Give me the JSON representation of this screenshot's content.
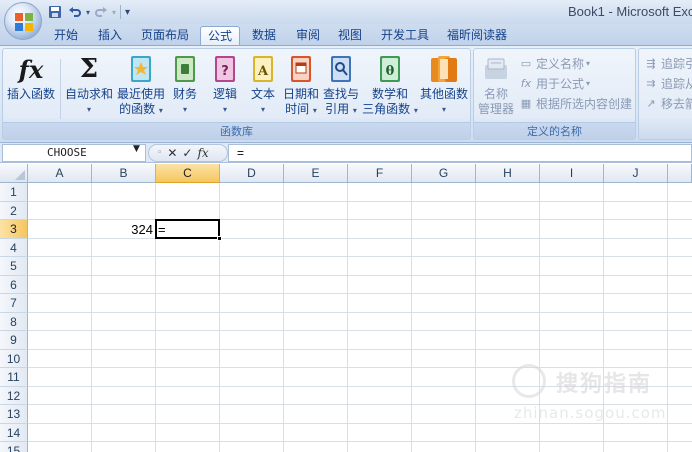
{
  "window": {
    "title": "Book1 - Microsoft Exc"
  },
  "quick_access": {
    "save": "save-icon",
    "undo": "undo-icon",
    "redo": "redo-icon",
    "customize": "▾"
  },
  "tabs": [
    "开始",
    "插入",
    "页面布局",
    "公式",
    "数据",
    "审阅",
    "视图",
    "开发工具",
    "福昕阅读器"
  ],
  "active_tab": "公式",
  "ribbon": {
    "function_library": {
      "label": "函数库",
      "insert_function": "插入函数",
      "autosum": "自动求和",
      "recent_l1": "最近使用",
      "recent_l2": "的函数",
      "financial": "财务",
      "logical": "逻辑",
      "text": "文本",
      "datetime_l1": "日期和",
      "datetime_l2": "时间",
      "lookup_l1": "查找与",
      "lookup_l2": "引用",
      "math_l1": "数学和",
      "math_l2": "三角函数",
      "more": "其他函数",
      "arrow": "▾"
    },
    "defined_names": {
      "label": "定义的名称",
      "name_manager_l1": "名称",
      "name_manager_l2": "管理器",
      "define_name": "定义名称",
      "use_in_formula": "用于公式",
      "create_from_selection": "根据所选内容创建"
    },
    "formula_auditing": {
      "trace_precedents": "追踪引",
      "trace_dependents": "追踪从",
      "remove_arrows": "移去箭"
    }
  },
  "formula_bar": {
    "name_box": "CHOOSE",
    "cancel": "✕",
    "enter": "✓",
    "fx": "fx",
    "content": "="
  },
  "sheet": {
    "columns": [
      "A",
      "B",
      "C",
      "D",
      "E",
      "F",
      "G",
      "H",
      "I",
      "J"
    ],
    "rows": [
      "1",
      "2",
      "3",
      "4",
      "5",
      "6",
      "7",
      "8",
      "9",
      "10",
      "11",
      "12",
      "13",
      "14",
      "15"
    ],
    "selected_column": "C",
    "selected_row": "3",
    "cells": {
      "B3": "324",
      "C3": "="
    }
  },
  "watermark": {
    "brand": "搜狗指南",
    "url": "zhinan.sogou.com"
  }
}
